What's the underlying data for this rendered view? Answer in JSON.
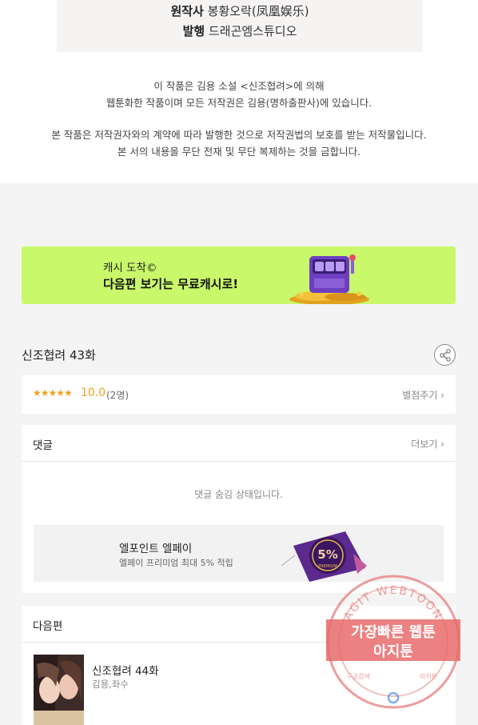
{
  "credits": [
    {
      "label": "원작사",
      "value": "봉황오락(凤凰娱乐)"
    },
    {
      "label": "발행",
      "value": "드래곤엠스튜디오"
    }
  ],
  "notice": {
    "line1": "이 작품은 김용 소설 <신조협려>에 의해",
    "line2": "웹툰화한 작품이며 모든 저작권은 김용(명하출판사)에 있습니다.",
    "line3": "본 작품은 저작권자와의 계약에 따라 발행한 것으로 저작권법의 보호를 받는 저작물입니다.",
    "line4": "본 서의 내용을 무단 전재 및 무단 복제하는 것을 금합니다."
  },
  "banner": {
    "line1": "캐시 도착©",
    "line2": "다음편 보기는 무료캐시로!",
    "bg_color": "#c9f86a"
  },
  "episode": {
    "title": "신조협려 43화",
    "share_icon": "share-icon"
  },
  "rating": {
    "stars": "★★★★★",
    "score": "10.0",
    "count": "(2명)",
    "rate_button": "별점주기 ›",
    "accent_color": "#f0a020"
  },
  "comments": {
    "title": "댓글",
    "more": "더보기 ›",
    "hidden_message": "댓글 숨김 상태입니다."
  },
  "promo": {
    "title": "엘포인트 엘페이",
    "subtitle": "엘페이 프리미엄 최대 5% 적립",
    "badge_percent": "5%",
    "badge_text": "PREMIUM"
  },
  "next_episode": {
    "section_title": "다음편",
    "title": "신조협려 44화",
    "authors": "김용,좌수"
  },
  "watermark": {
    "ring_text": "AGIT WEBTOON",
    "line1": "가장빠른 웹툰",
    "line2": "아지툰",
    "small_left": "구글검색",
    "small_right": "아지툰"
  }
}
